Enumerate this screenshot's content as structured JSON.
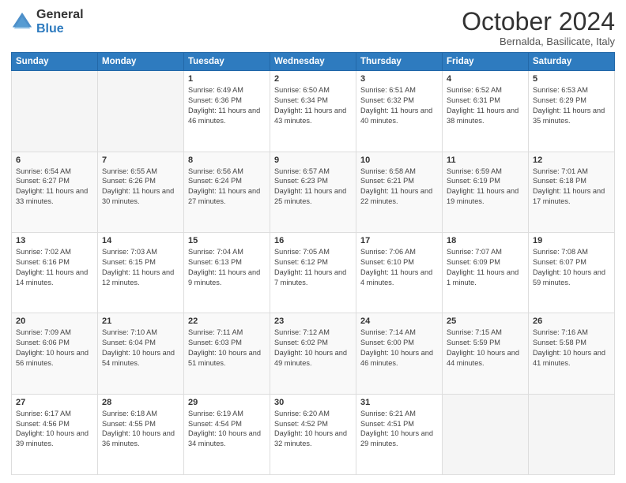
{
  "logo": {
    "general": "General",
    "blue": "Blue"
  },
  "title": "October 2024",
  "subtitle": "Bernalda, Basilicate, Italy",
  "days_of_week": [
    "Sunday",
    "Monday",
    "Tuesday",
    "Wednesday",
    "Thursday",
    "Friday",
    "Saturday"
  ],
  "weeks": [
    [
      {
        "day": "",
        "info": ""
      },
      {
        "day": "",
        "info": ""
      },
      {
        "day": "1",
        "info": "Sunrise: 6:49 AM\nSunset: 6:36 PM\nDaylight: 11 hours and 46 minutes."
      },
      {
        "day": "2",
        "info": "Sunrise: 6:50 AM\nSunset: 6:34 PM\nDaylight: 11 hours and 43 minutes."
      },
      {
        "day": "3",
        "info": "Sunrise: 6:51 AM\nSunset: 6:32 PM\nDaylight: 11 hours and 40 minutes."
      },
      {
        "day": "4",
        "info": "Sunrise: 6:52 AM\nSunset: 6:31 PM\nDaylight: 11 hours and 38 minutes."
      },
      {
        "day": "5",
        "info": "Sunrise: 6:53 AM\nSunset: 6:29 PM\nDaylight: 11 hours and 35 minutes."
      }
    ],
    [
      {
        "day": "6",
        "info": "Sunrise: 6:54 AM\nSunset: 6:27 PM\nDaylight: 11 hours and 33 minutes."
      },
      {
        "day": "7",
        "info": "Sunrise: 6:55 AM\nSunset: 6:26 PM\nDaylight: 11 hours and 30 minutes."
      },
      {
        "day": "8",
        "info": "Sunrise: 6:56 AM\nSunset: 6:24 PM\nDaylight: 11 hours and 27 minutes."
      },
      {
        "day": "9",
        "info": "Sunrise: 6:57 AM\nSunset: 6:23 PM\nDaylight: 11 hours and 25 minutes."
      },
      {
        "day": "10",
        "info": "Sunrise: 6:58 AM\nSunset: 6:21 PM\nDaylight: 11 hours and 22 minutes."
      },
      {
        "day": "11",
        "info": "Sunrise: 6:59 AM\nSunset: 6:19 PM\nDaylight: 11 hours and 19 minutes."
      },
      {
        "day": "12",
        "info": "Sunrise: 7:01 AM\nSunset: 6:18 PM\nDaylight: 11 hours and 17 minutes."
      }
    ],
    [
      {
        "day": "13",
        "info": "Sunrise: 7:02 AM\nSunset: 6:16 PM\nDaylight: 11 hours and 14 minutes."
      },
      {
        "day": "14",
        "info": "Sunrise: 7:03 AM\nSunset: 6:15 PM\nDaylight: 11 hours and 12 minutes."
      },
      {
        "day": "15",
        "info": "Sunrise: 7:04 AM\nSunset: 6:13 PM\nDaylight: 11 hours and 9 minutes."
      },
      {
        "day": "16",
        "info": "Sunrise: 7:05 AM\nSunset: 6:12 PM\nDaylight: 11 hours and 7 minutes."
      },
      {
        "day": "17",
        "info": "Sunrise: 7:06 AM\nSunset: 6:10 PM\nDaylight: 11 hours and 4 minutes."
      },
      {
        "day": "18",
        "info": "Sunrise: 7:07 AM\nSunset: 6:09 PM\nDaylight: 11 hours and 1 minute."
      },
      {
        "day": "19",
        "info": "Sunrise: 7:08 AM\nSunset: 6:07 PM\nDaylight: 10 hours and 59 minutes."
      }
    ],
    [
      {
        "day": "20",
        "info": "Sunrise: 7:09 AM\nSunset: 6:06 PM\nDaylight: 10 hours and 56 minutes."
      },
      {
        "day": "21",
        "info": "Sunrise: 7:10 AM\nSunset: 6:04 PM\nDaylight: 10 hours and 54 minutes."
      },
      {
        "day": "22",
        "info": "Sunrise: 7:11 AM\nSunset: 6:03 PM\nDaylight: 10 hours and 51 minutes."
      },
      {
        "day": "23",
        "info": "Sunrise: 7:12 AM\nSunset: 6:02 PM\nDaylight: 10 hours and 49 minutes."
      },
      {
        "day": "24",
        "info": "Sunrise: 7:14 AM\nSunset: 6:00 PM\nDaylight: 10 hours and 46 minutes."
      },
      {
        "day": "25",
        "info": "Sunrise: 7:15 AM\nSunset: 5:59 PM\nDaylight: 10 hours and 44 minutes."
      },
      {
        "day": "26",
        "info": "Sunrise: 7:16 AM\nSunset: 5:58 PM\nDaylight: 10 hours and 41 minutes."
      }
    ],
    [
      {
        "day": "27",
        "info": "Sunrise: 6:17 AM\nSunset: 4:56 PM\nDaylight: 10 hours and 39 minutes."
      },
      {
        "day": "28",
        "info": "Sunrise: 6:18 AM\nSunset: 4:55 PM\nDaylight: 10 hours and 36 minutes."
      },
      {
        "day": "29",
        "info": "Sunrise: 6:19 AM\nSunset: 4:54 PM\nDaylight: 10 hours and 34 minutes."
      },
      {
        "day": "30",
        "info": "Sunrise: 6:20 AM\nSunset: 4:52 PM\nDaylight: 10 hours and 32 minutes."
      },
      {
        "day": "31",
        "info": "Sunrise: 6:21 AM\nSunset: 4:51 PM\nDaylight: 10 hours and 29 minutes."
      },
      {
        "day": "",
        "info": ""
      },
      {
        "day": "",
        "info": ""
      }
    ]
  ]
}
